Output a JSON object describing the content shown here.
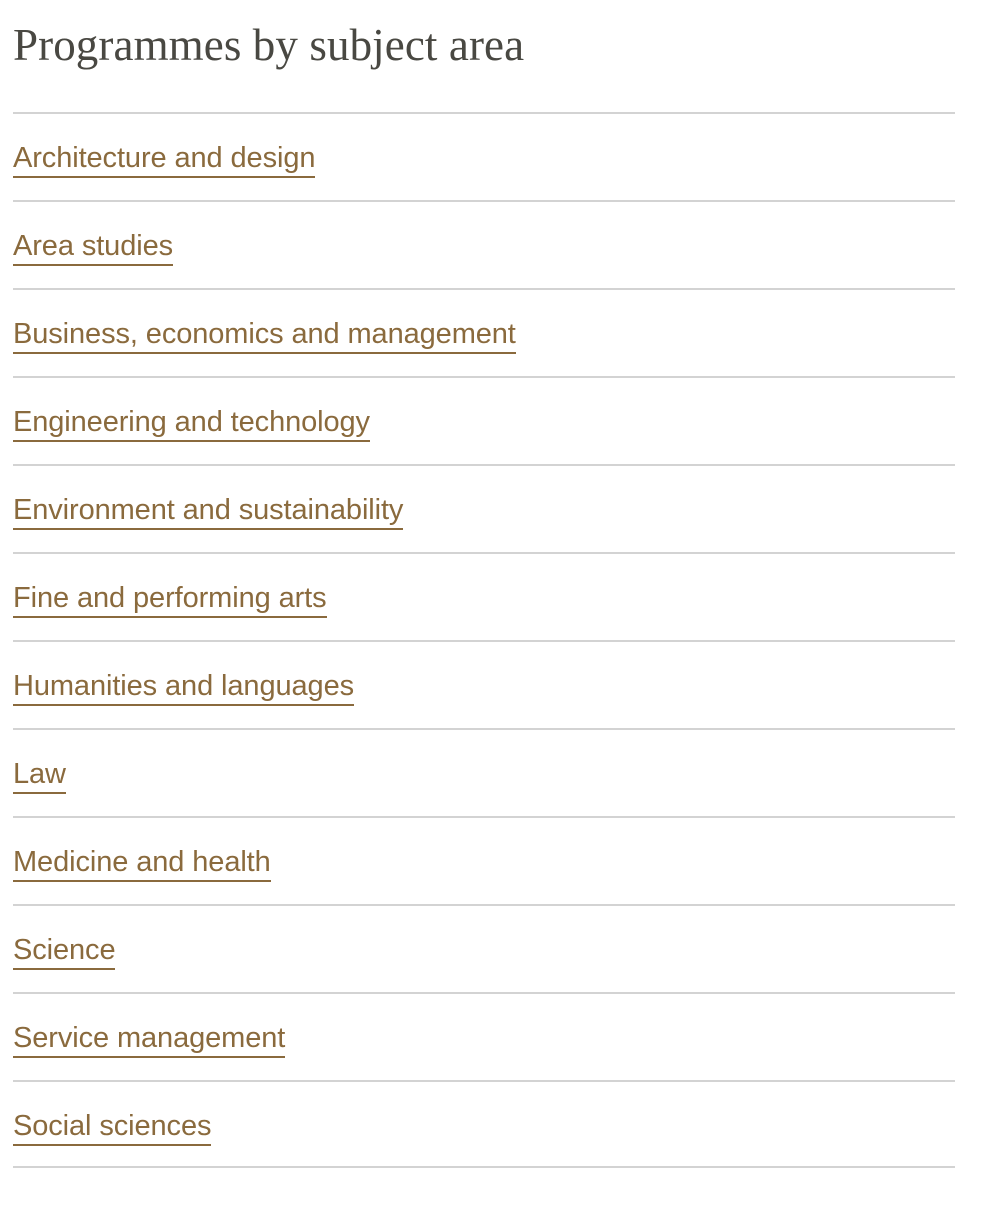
{
  "page": {
    "title": "Programmes by subject area"
  },
  "subject_areas": [
    {
      "label": "Architecture and design"
    },
    {
      "label": "Area studies"
    },
    {
      "label": "Business, economics and management"
    },
    {
      "label": "Engineering and technology"
    },
    {
      "label": "Environment and sustainability"
    },
    {
      "label": "Fine and performing arts"
    },
    {
      "label": "Humanities and languages"
    },
    {
      "label": "Law"
    },
    {
      "label": "Medicine and health"
    },
    {
      "label": "Science"
    },
    {
      "label": "Service management"
    },
    {
      "label": "Social sciences"
    }
  ],
  "colors": {
    "link": "#8a6a3d",
    "title": "#494842",
    "divider": "#d3d3d3",
    "background": "#ffffff"
  }
}
